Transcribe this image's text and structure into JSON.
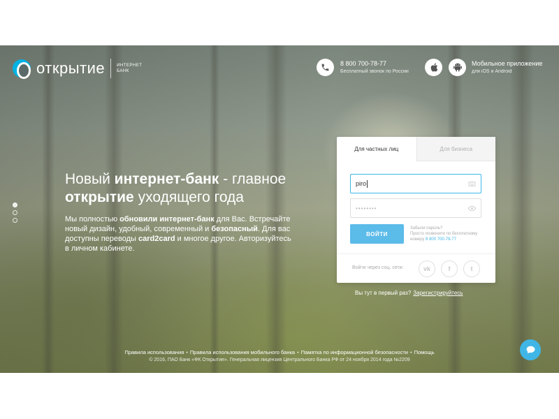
{
  "header": {
    "logo_text": "открытие",
    "logo_sub": "ИНТЕРНЕТ БАНК",
    "phone_number": "8 800 700-78-77",
    "phone_note": "Бесплатный звонок по России",
    "app_title": "Мобильное приложение",
    "app_note": "для iOS и Android"
  },
  "promo": {
    "headline_part1": "Новый ",
    "headline_bold1": "интернет-банк",
    "headline_part2": " - главное ",
    "headline_bold2": "открытие",
    "headline_part3": " уходящего года",
    "body_1": "Мы полностью ",
    "body_b1": "обновили интернет-банк",
    "body_2": " для Вас. Встречайте новый дизайн, удобный, современный и ",
    "body_b2": "безопасный",
    "body_3": ". Для вас доступны переводы ",
    "body_b3": "card2card",
    "body_4": " и многое другое. Авторизуйтесь в личном кабинете."
  },
  "login": {
    "tab_personal": "Для частных лиц",
    "tab_business": "Для бизнеса",
    "login_value": "piro",
    "password_mask": "••••••••",
    "submit_label": "ВОЙТИ",
    "forgot_title": "Забыли пароль?",
    "forgot_text": "Просто позвоните по бесплатному номеру",
    "forgot_phone": "8 800 700-78-77",
    "social_label": "Войти через соц. сети:",
    "social_vk": "vk",
    "social_fb": "f",
    "social_tw": "t"
  },
  "register": {
    "question": "Вы тут в первый раз?",
    "link": "Зарегистрируйтесь"
  },
  "footer": {
    "links": [
      "Правила использования",
      "Правила использования мобильного банка",
      "Памятка по информационной безопасности",
      "Помощь"
    ],
    "separator": "•",
    "copyright": "© 2016, ПАО Банк «ФК Открытие». Генеральная лицензия Центрального Банка РФ от 24 ноября 2014 года №2209"
  },
  "colors": {
    "accent": "#3fb6e6",
    "button": "#5bbbe9",
    "brand": "#00b2e3"
  },
  "icons": {
    "phone": "phone-icon",
    "apple": "apple-icon",
    "android": "android-icon",
    "chat": "chat-icon"
  }
}
